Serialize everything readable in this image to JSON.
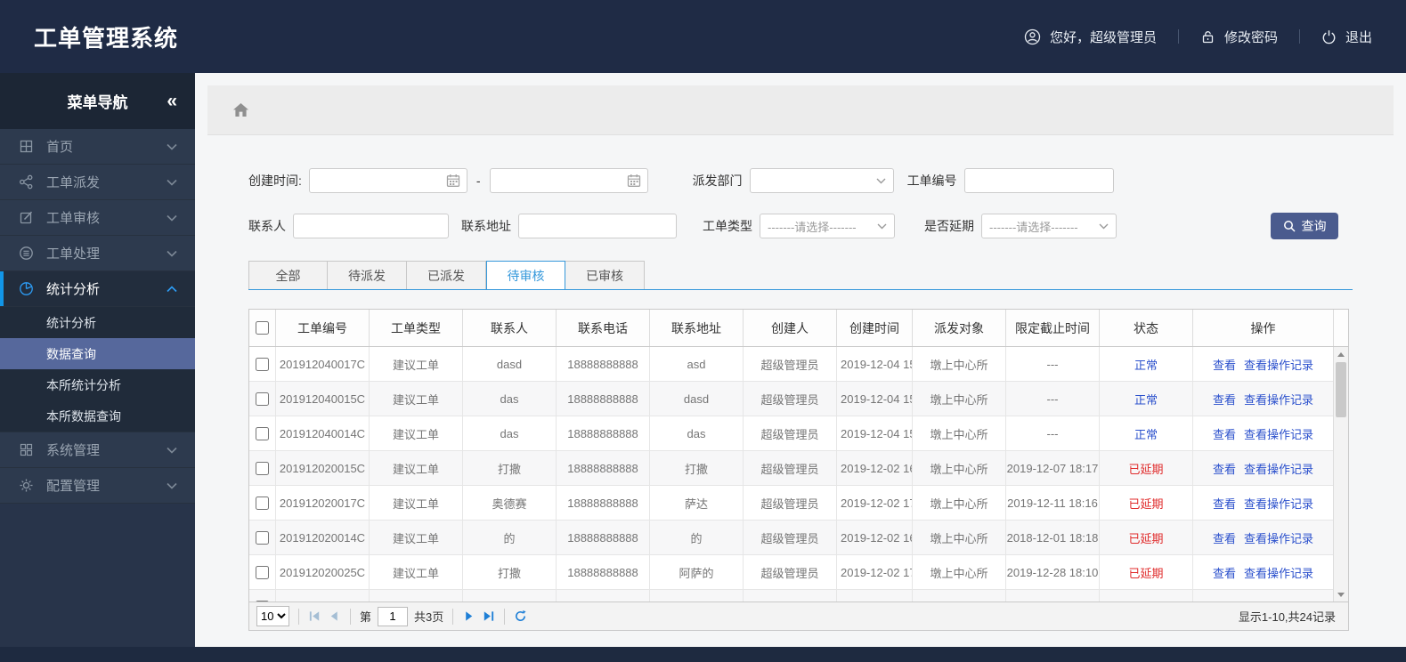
{
  "app": {
    "title": "工单管理系统",
    "greeting": "您好，超级管理员",
    "change_password": "修改密码",
    "logout": "退出"
  },
  "sidebar": {
    "header": "菜单导航",
    "collapse_glyph": "«",
    "items": [
      {
        "label": "首页"
      },
      {
        "label": "工单派发"
      },
      {
        "label": "工单审核"
      },
      {
        "label": "工单处理"
      },
      {
        "label": "统计分析",
        "expanded": true,
        "children": [
          {
            "label": "统计分析"
          },
          {
            "label": "数据查询",
            "selected": true
          },
          {
            "label": "本所统计分析"
          },
          {
            "label": "本所数据查询"
          }
        ]
      },
      {
        "label": "系统管理"
      },
      {
        "label": "配置管理"
      }
    ]
  },
  "filters": {
    "create_time_label": "创建时间:",
    "range_separator": "-",
    "dept_label": "派发部门",
    "order_no_label": "工单编号",
    "contact_label": "联系人",
    "address_label": "联系地址",
    "type_label": "工单类型",
    "type_placeholder": "-------请选择-------",
    "delay_label": "是否延期",
    "delay_placeholder": "-------请选择-------",
    "search_label": "查询"
  },
  "tabs": [
    {
      "label": "全部"
    },
    {
      "label": "待派发"
    },
    {
      "label": "已派发"
    },
    {
      "label": "待审核",
      "active": true
    },
    {
      "label": "已审核"
    }
  ],
  "table": {
    "columns": [
      "工单编号",
      "工单类型",
      "联系人",
      "联系电话",
      "联系地址",
      "创建人",
      "创建时间",
      "派发对象",
      "限定截止时间",
      "状态",
      "操作"
    ],
    "action_labels": [
      "查看",
      "查看操作记录"
    ],
    "rows": [
      {
        "no": "201912040017C",
        "type": "建议工单",
        "contact": "dasd",
        "phone": "18888888888",
        "addr": "asd",
        "creator": "超级管理员",
        "ctime": "2019-12-04 15",
        "target": "墩上中心所",
        "deadline": "---",
        "status": "正常",
        "delayed": false,
        "actions": true
      },
      {
        "no": "201912040015C",
        "type": "建议工单",
        "contact": "das",
        "phone": "18888888888",
        "addr": "dasd",
        "creator": "超级管理员",
        "ctime": "2019-12-04 15",
        "target": "墩上中心所",
        "deadline": "---",
        "status": "正常",
        "delayed": false,
        "actions": true
      },
      {
        "no": "201912040014C",
        "type": "建议工单",
        "contact": "das",
        "phone": "18888888888",
        "addr": "das",
        "creator": "超级管理员",
        "ctime": "2019-12-04 15",
        "target": "墩上中心所",
        "deadline": "---",
        "status": "正常",
        "delayed": false,
        "actions": true
      },
      {
        "no": "201912020015C",
        "type": "建议工单",
        "contact": "打撒",
        "phone": "18888888888",
        "addr": "打撒",
        "creator": "超级管理员",
        "ctime": "2019-12-02 16",
        "target": "墩上中心所",
        "deadline": "2019-12-07 18:17",
        "status": "已延期",
        "delayed": true,
        "actions": true
      },
      {
        "no": "201912020017C",
        "type": "建议工单",
        "contact": "奥德赛",
        "phone": "18888888888",
        "addr": "萨达",
        "creator": "超级管理员",
        "ctime": "2019-12-02 17",
        "target": "墩上中心所",
        "deadline": "2019-12-11 18:16",
        "status": "已延期",
        "delayed": true,
        "actions": true
      },
      {
        "no": "201912020014C",
        "type": "建议工单",
        "contact": "的",
        "phone": "18888888888",
        "addr": "的",
        "creator": "超级管理员",
        "ctime": "2019-12-02 16",
        "target": "墩上中心所",
        "deadline": "2018-12-01 18:18",
        "status": "已延期",
        "delayed": true,
        "actions": true
      },
      {
        "no": "201912020025C",
        "type": "建议工单",
        "contact": "打撒",
        "phone": "18888888888",
        "addr": "阿萨的",
        "creator": "超级管理员",
        "ctime": "2019-12-02 17",
        "target": "墩上中心所",
        "deadline": "2019-12-28 18:10",
        "status": "已延期",
        "delayed": true,
        "actions": true
      },
      {
        "no": "",
        "type": "",
        "contact": "",
        "phone": "",
        "addr": "",
        "creator": "",
        "ctime": "",
        "target": "",
        "deadline": "",
        "status": "",
        "delayed": false,
        "actions": false
      }
    ]
  },
  "pagination": {
    "page_size": "10",
    "page_label_prefix": "第",
    "current_page": "1",
    "total_pages_label": "共3页",
    "summary": "显示1-10,共24记录"
  },
  "icons": {
    "collapse": "«",
    "user": "person-in-circle",
    "password": "lock",
    "logout": "power",
    "home": "house",
    "calendar": "calendar-grid",
    "search": "magnifier",
    "refresh": "circular-arrow"
  },
  "colors": {
    "topbar_bg": "#1f2b45",
    "sidebar_bg": "#2d3a4e",
    "selected_submenu_bg": "#56689c",
    "active_menu_blue": "#2d9cf4",
    "tab_accent_blue": "#3598db",
    "link_blue": "#2b50cc",
    "status_delayed_red": "#e02b2b",
    "search_button_bg": "#4a5b8e"
  }
}
